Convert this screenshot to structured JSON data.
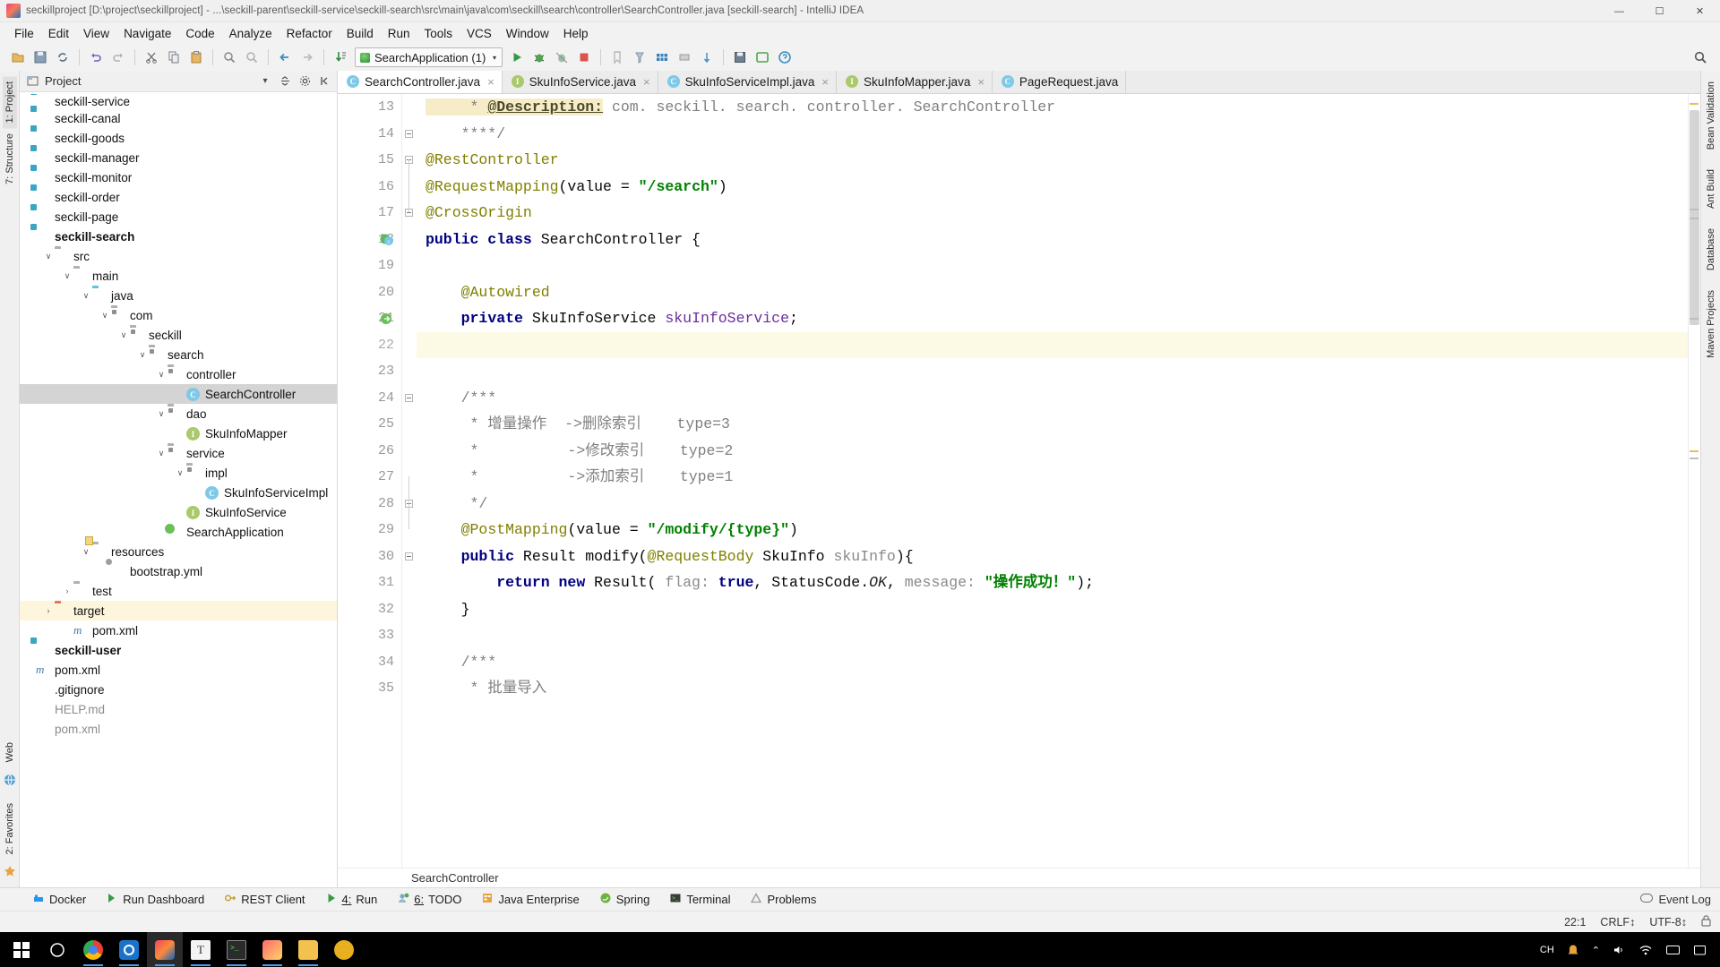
{
  "window": {
    "title": "seckillproject [D:\\project\\seckillproject] - ...\\seckill-parent\\seckill-service\\seckill-search\\src\\main\\java\\com\\seckill\\search\\controller\\SearchController.java [seckill-search] - IntelliJ IDEA",
    "minimize": "—",
    "maximize": "☐",
    "close": "✕"
  },
  "menu": [
    "File",
    "Edit",
    "View",
    "Navigate",
    "Code",
    "Analyze",
    "Refactor",
    "Build",
    "Run",
    "Tools",
    "VCS",
    "Window",
    "Help"
  ],
  "toolbar": {
    "run_config": "SearchApplication (1)",
    "run_config_caret": "▾",
    "search_everywhere": "search-icon"
  },
  "left_rail": {
    "top": [
      "1: Project",
      "7: Structure"
    ],
    "bottom": [
      "Web",
      "2: Favorites"
    ]
  },
  "right_rail": [
    "Bean Validation",
    "Ant Build",
    "Database",
    "Maven Projects"
  ],
  "project_panel": {
    "title": "Project",
    "caret": "▾",
    "tree": [
      {
        "label": "seckill-service",
        "depth": 1,
        "icon": "module-icon",
        "arrow": "",
        "state": "clipped"
      },
      {
        "label": "seckill-canal",
        "depth": 1,
        "icon": "module-icon",
        "arrow": ""
      },
      {
        "label": "seckill-goods",
        "depth": 1,
        "icon": "module-icon",
        "arrow": ""
      },
      {
        "label": "seckill-manager",
        "depth": 1,
        "icon": "module-icon",
        "arrow": ""
      },
      {
        "label": "seckill-monitor",
        "depth": 1,
        "icon": "module-icon",
        "arrow": ""
      },
      {
        "label": "seckill-order",
        "depth": 1,
        "icon": "module-icon",
        "arrow": ""
      },
      {
        "label": "seckill-page",
        "depth": 1,
        "icon": "module-icon",
        "arrow": ""
      },
      {
        "label": "seckill-search",
        "depth": 1,
        "icon": "module-icon",
        "arrow": "",
        "bold": true
      },
      {
        "label": "src",
        "depth": 2,
        "icon": "folder-icon",
        "arrow": "∨"
      },
      {
        "label": "main",
        "depth": 3,
        "icon": "folder-icon",
        "arrow": "∨"
      },
      {
        "label": "java",
        "depth": 4,
        "icon": "source-folder-icon",
        "arrow": "∨"
      },
      {
        "label": "com",
        "depth": 5,
        "icon": "package-icon",
        "arrow": "∨"
      },
      {
        "label": "seckill",
        "depth": 6,
        "icon": "package-icon",
        "arrow": "∨"
      },
      {
        "label": "search",
        "depth": 7,
        "icon": "package-icon",
        "arrow": "∨"
      },
      {
        "label": "controller",
        "depth": 8,
        "icon": "package-icon",
        "arrow": "∨"
      },
      {
        "label": "SearchController",
        "depth": 9,
        "icon": "class-icon",
        "arrow": "",
        "selected": true
      },
      {
        "label": "dao",
        "depth": 8,
        "icon": "package-icon",
        "arrow": "∨"
      },
      {
        "label": "SkuInfoMapper",
        "depth": 9,
        "icon": "interface-icon",
        "arrow": ""
      },
      {
        "label": "service",
        "depth": 8,
        "icon": "package-icon",
        "arrow": "∨"
      },
      {
        "label": "impl",
        "depth": 9,
        "icon": "package-icon",
        "arrow": "∨"
      },
      {
        "label": "SkuInfoServiceImpl",
        "depth": 10,
        "icon": "class-icon",
        "arrow": ""
      },
      {
        "label": "SkuInfoService",
        "depth": 9,
        "icon": "interface-icon",
        "arrow": ""
      },
      {
        "label": "SearchApplication",
        "depth": 8,
        "icon": "spring-class-icon",
        "arrow": ""
      },
      {
        "label": "resources",
        "depth": 4,
        "icon": "resource-folder-icon",
        "arrow": "∨"
      },
      {
        "label": "bootstrap.yml",
        "depth": 5,
        "icon": "yml-icon",
        "arrow": ""
      },
      {
        "label": "test",
        "depth": 3,
        "icon": "folder-icon",
        "arrow": "›"
      },
      {
        "label": "target",
        "depth": 2,
        "icon": "target-folder-icon",
        "arrow": "›",
        "highlight": true
      },
      {
        "label": "pom.xml",
        "depth": 3,
        "icon": "maven-icon",
        "arrow": ""
      },
      {
        "label": "seckill-user",
        "depth": 1,
        "icon": "module-icon",
        "arrow": "",
        "bold": true
      },
      {
        "label": "pom.xml",
        "depth": 1,
        "icon": "maven-icon",
        "arrow": ""
      },
      {
        "label": ".gitignore",
        "depth": 1,
        "icon": "",
        "arrow": ""
      },
      {
        "label": "HELP.md",
        "depth": 1,
        "icon": "",
        "arrow": "",
        "dim": true
      },
      {
        "label": "pom.xml",
        "depth": 1,
        "icon": "",
        "arrow": "",
        "dim": true
      }
    ]
  },
  "editor": {
    "tabs": [
      {
        "label": "SearchController.java",
        "icon": "class-icon",
        "kind": "c",
        "active": true,
        "closable": true
      },
      {
        "label": "SkuInfoService.java",
        "icon": "interface-icon",
        "kind": "i",
        "active": false,
        "closable": true
      },
      {
        "label": "SkuInfoServiceImpl.java",
        "icon": "class-icon",
        "kind": "c",
        "active": false,
        "closable": true
      },
      {
        "label": "SkuInfoMapper.java",
        "icon": "interface-icon",
        "kind": "i",
        "active": false,
        "closable": true
      },
      {
        "label": "PageRequest.java",
        "icon": "class-icon",
        "kind": "c",
        "active": false,
        "closable": false
      }
    ],
    "first_line_number": 13,
    "breadcrumb": "SearchController",
    "lines": [
      {
        "n": 13,
        "tokens": [
          {
            "t": "     * ",
            "c": "cmt cmt-hl"
          },
          {
            "t": "@Description:",
            "c": "desc"
          },
          {
            "t": " com. seckill. search. controller. SearchController",
            "c": "cmt"
          }
        ]
      },
      {
        "n": 14,
        "tokens": [
          {
            "t": "    ****/",
            "c": "cmt"
          }
        ],
        "fold": "end"
      },
      {
        "n": 15,
        "tokens": [
          {
            "t": "@RestController",
            "c": "anno"
          }
        ],
        "fold": "start"
      },
      {
        "n": 16,
        "tokens": [
          {
            "t": "@RequestMapping",
            "c": "anno"
          },
          {
            "t": "(value = ",
            "c": "plain"
          },
          {
            "t": "\"/search\"",
            "c": "str"
          },
          {
            "t": ")",
            "c": "plain"
          }
        ]
      },
      {
        "n": 17,
        "tokens": [
          {
            "t": "@CrossOrigin",
            "c": "anno"
          }
        ],
        "fold": "mid"
      },
      {
        "n": 18,
        "tokens": [
          {
            "t": "public class ",
            "c": "kw"
          },
          {
            "t": "SearchController {",
            "c": "plain"
          }
        ],
        "mark": "spring-bean-gutter-icon"
      },
      {
        "n": 19,
        "tokens": []
      },
      {
        "n": 20,
        "tokens": [
          {
            "t": "    ",
            "c": "plain"
          },
          {
            "t": "@Autowired",
            "c": "anno"
          }
        ]
      },
      {
        "n": 21,
        "tokens": [
          {
            "t": "    ",
            "c": "plain"
          },
          {
            "t": "private ",
            "c": "kw"
          },
          {
            "t": "SkuInfoService ",
            "c": "plain"
          },
          {
            "t": "skuInfoService",
            "c": "fld"
          },
          {
            "t": ";",
            "c": "plain"
          }
        ],
        "mark": "autowired-gutter-icon"
      },
      {
        "n": 22,
        "tokens": [],
        "current": true
      },
      {
        "n": 23,
        "tokens": []
      },
      {
        "n": 24,
        "tokens": [
          {
            "t": "    /***",
            "c": "cmt"
          }
        ],
        "fold": "start"
      },
      {
        "n": 25,
        "tokens": [
          {
            "t": "     * 增量操作  ->删除索引    type=3",
            "c": "cmt"
          }
        ]
      },
      {
        "n": 26,
        "tokens": [
          {
            "t": "     *          ->修改索引    type=2",
            "c": "cmt"
          }
        ]
      },
      {
        "n": 27,
        "tokens": [
          {
            "t": "     *          ->添加索引    type=1",
            "c": "cmt"
          }
        ]
      },
      {
        "n": 28,
        "tokens": [
          {
            "t": "     */",
            "c": "cmt"
          }
        ],
        "fold": "end"
      },
      {
        "n": 29,
        "tokens": [
          {
            "t": "    ",
            "c": "plain"
          },
          {
            "t": "@PostMapping",
            "c": "anno"
          },
          {
            "t": "(value = ",
            "c": "plain"
          },
          {
            "t": "\"/modify/{type}\"",
            "c": "str"
          },
          {
            "t": ")",
            "c": "plain"
          }
        ]
      },
      {
        "n": 30,
        "tokens": [
          {
            "t": "    ",
            "c": "plain"
          },
          {
            "t": "public ",
            "c": "kw"
          },
          {
            "t": "Result modify(",
            "c": "plain"
          },
          {
            "t": "@RequestBody",
            "c": "anno"
          },
          {
            "t": " SkuInfo ",
            "c": "plain"
          },
          {
            "t": "skuInfo",
            "c": "param"
          },
          {
            "t": "){",
            "c": "plain"
          }
        ],
        "fold": "start"
      },
      {
        "n": 31,
        "tokens": [
          {
            "t": "        ",
            "c": "plain"
          },
          {
            "t": "return new ",
            "c": "kw"
          },
          {
            "t": "Result(",
            "c": "plain"
          },
          {
            "t": " flag:",
            "c": "param"
          },
          {
            "t": " ",
            "c": "plain"
          },
          {
            "t": "true",
            "c": "kw"
          },
          {
            "t": ", StatusCode.",
            "c": "plain"
          },
          {
            "t": "OK",
            "c": "stat"
          },
          {
            "t": ",",
            "c": "plain"
          },
          {
            "t": " message:",
            "c": "param"
          },
          {
            "t": " ",
            "c": "plain"
          },
          {
            "t": "\"操作成功！\"",
            "c": "str"
          },
          {
            "t": ");",
            "c": "plain"
          }
        ]
      },
      {
        "n": 32,
        "tokens": [
          {
            "t": "    }",
            "c": "plain"
          }
        ]
      },
      {
        "n": 33,
        "tokens": []
      },
      {
        "n": 34,
        "tokens": [
          {
            "t": "    /***",
            "c": "cmt"
          }
        ]
      },
      {
        "n": 35,
        "tokens": [
          {
            "t": "     * 批量导入",
            "c": "cmt"
          }
        ]
      }
    ]
  },
  "bottom_tools": [
    {
      "label": "Docker",
      "icon": "docker-icon",
      "mnemonic": ""
    },
    {
      "label": "Run Dashboard",
      "icon": "run-dashboard-icon",
      "mnemonic": ""
    },
    {
      "label": "REST Client",
      "icon": "rest-client-icon",
      "mnemonic": ""
    },
    {
      "label": "Run",
      "icon": "run-icon",
      "mnemonic": "4:"
    },
    {
      "label": "TODO",
      "icon": "todo-icon",
      "mnemonic": "6:"
    },
    {
      "label": "Java Enterprise",
      "icon": "java-enterprise-icon",
      "mnemonic": ""
    },
    {
      "label": "Spring",
      "icon": "spring-icon",
      "mnemonic": ""
    },
    {
      "label": "Terminal",
      "icon": "terminal-icon",
      "mnemonic": ""
    },
    {
      "label": "Problems",
      "icon": "problems-icon",
      "mnemonic": ""
    }
  ],
  "bottom_right": {
    "event_log": "Event Log",
    "event_log_icon": "message-icon"
  },
  "status_bar": {
    "caret_position": "22:1",
    "line_separator": "CRLF↕",
    "encoding": "UTF-8↕",
    "lock_icon": "lock-icon"
  },
  "taskbar": {
    "start": "start-icon",
    "search": "search-circle-icon",
    "items": [
      {
        "name": "chrome-icon",
        "active": false,
        "running": true
      },
      {
        "name": "app-blue-icon",
        "active": false,
        "running": true
      },
      {
        "name": "intellij-idea-icon",
        "active": true,
        "running": true
      },
      {
        "name": "text-editor-icon",
        "active": false,
        "running": true
      },
      {
        "name": "terminal-app-icon",
        "active": false,
        "running": true
      },
      {
        "name": "paint-icon",
        "active": false,
        "running": true
      },
      {
        "name": "file-explorer-icon",
        "active": false,
        "running": true
      },
      {
        "name": "wechat-icon",
        "active": false,
        "running": false
      }
    ],
    "tray": {
      "ime": "CH",
      "notification": "notification-icon",
      "chevron": "⌃",
      "volume": "volume-icon",
      "network": "network-icon",
      "keyboard": "keyboard-icon",
      "action_center": "action-center-icon"
    }
  }
}
